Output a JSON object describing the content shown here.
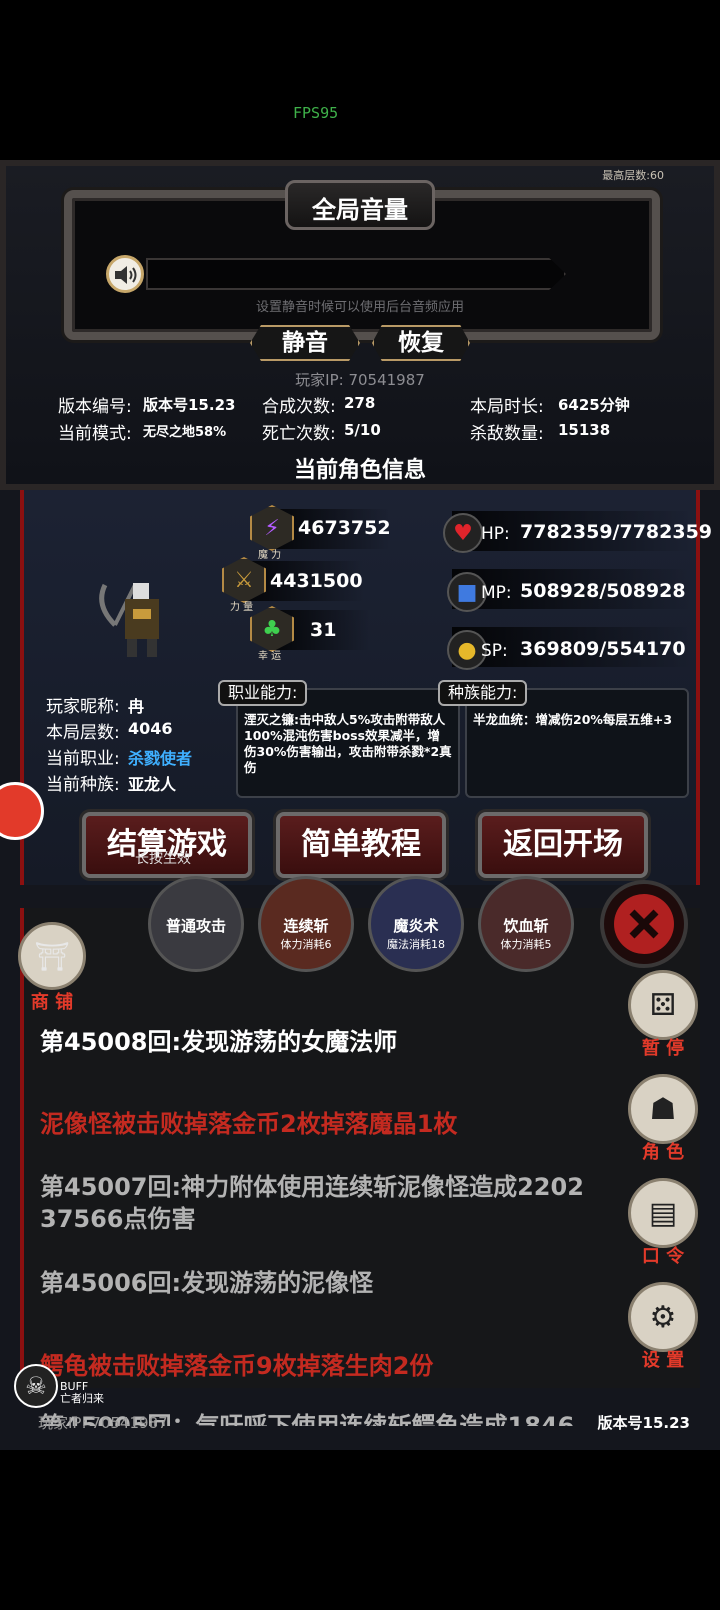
{
  "overlay": {
    "fps": "FPS95",
    "highest_floor": "最高层数:60"
  },
  "volume": {
    "title": "全局音量",
    "hint": "设置静音时候可以使用后台音频应用",
    "mute_label": "静音",
    "restore_label": "恢复"
  },
  "player_ip": "玩家IP:  70541987",
  "stats": {
    "version_label": "版本编号:",
    "version_val": "版本号15.23",
    "mode_label": "当前模式:",
    "mode_val": "无尽之地58%",
    "craft_label": "合成次数:",
    "craft_val": "278",
    "death_label": "死亡次数:",
    "death_val": "5/10",
    "time_label": "本局时长:",
    "time_val": "6425分钟",
    "kills_label": "杀敌数量:",
    "kills_val": "15138"
  },
  "character": {
    "title": "当前角色信息",
    "magic_val": "4673752",
    "magic_label": "魔 力",
    "power_val": "4431500",
    "power_label": "力 量",
    "luck_val": "31",
    "luck_label": "幸 运",
    "hp_label": "HP:",
    "hp_val": "7782359/7782359",
    "mp_label": "MP:",
    "mp_val": "508928/508928",
    "sp_label": "SP:",
    "sp_val": "369809/554170",
    "nick_label": "玩家昵称:",
    "nick_val": "冉",
    "floor_label": "本局层数:",
    "floor_val": "4046",
    "job_label": "当前职业:",
    "job_val": "杀戮使者",
    "race_label": "当前种族:",
    "race_val": "亚龙人",
    "job_ability_tab": "职业能力:",
    "job_ability_text": "湮灭之镰:击中敌人5%攻击附带敌人100%混沌伤害boss效果减半，增伤30%伤害输出，攻击附带杀戮*2真伤",
    "race_ability_tab": "种族能力:",
    "race_ability_text": "半龙血统：增减伤20%每层五维+3",
    "job_color": "#3fb0ff"
  },
  "actions": {
    "settle_label": "结算游戏",
    "settle_hint": "长按生效",
    "tutorial_label": "简单教程",
    "return_label": "返回开场"
  },
  "skills": [
    {
      "name": "普通攻击",
      "cost": ""
    },
    {
      "name": "连续斩",
      "cost": "体力消耗6"
    },
    {
      "name": "魔炎术",
      "cost": "魔法消耗18"
    },
    {
      "name": "饮血斩",
      "cost": "体力消耗5"
    }
  ],
  "side_menu": {
    "shop": "商 铺",
    "pause": "暂 停",
    "role": "角 色",
    "command": "口 令",
    "settings": "设 置"
  },
  "log": [
    {
      "text": "第45008回:发现游荡的女魔法师",
      "style": "white"
    },
    {
      "text": "泥像怪被击败掉落金币2枚掉落魔晶1枚",
      "style": "red"
    },
    {
      "text": "第45007回:神力附体使用连续斩泥像怪造成2202",
      "style": "gray"
    },
    {
      "text": "37566点伤害",
      "style": "gray"
    },
    {
      "text": "第45006回:发现游荡的泥像怪",
      "style": "gray"
    },
    {
      "text": "鳄龟被击败掉落金币9枚掉落生肉2份",
      "style": "red"
    },
    {
      "text": "第45005回：气吁呼下使用连续斩鳄龟造成1846",
      "style": "gray"
    }
  ],
  "buff": {
    "label": "BUFF",
    "name": "亡者归来"
  },
  "footer": {
    "ip": "玩家IP:  70541987",
    "version": "版本号15.23"
  }
}
